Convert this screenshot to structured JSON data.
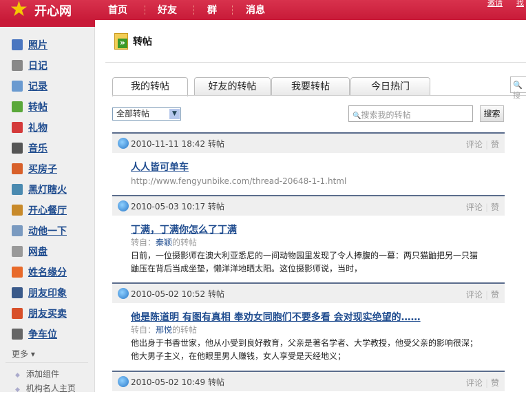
{
  "header": {
    "logo": "开心网",
    "nav": [
      "首页",
      "好友",
      "群",
      "消息"
    ],
    "top_links": [
      "邀请",
      "找"
    ]
  },
  "sidebar": {
    "items": [
      {
        "label": "照片",
        "icon": "photo-icon",
        "color": "#4a76c0"
      },
      {
        "label": "日记",
        "icon": "diary-icon",
        "color": "#888888"
      },
      {
        "label": "记录",
        "icon": "record-icon",
        "color": "#6a9ad0"
      },
      {
        "label": "转帖",
        "icon": "repost-icon",
        "color": "#5aa83a"
      },
      {
        "label": "礼物",
        "icon": "gift-icon",
        "color": "#d43a3a"
      },
      {
        "label": "音乐",
        "icon": "headphones-icon",
        "color": "#555555"
      },
      {
        "label": "买房子",
        "icon": "house-icon",
        "color": "#d8602a"
      },
      {
        "label": "黑灯瞎火",
        "icon": "people-icon",
        "color": "#4a8ab0"
      },
      {
        "label": "开心餐厅",
        "icon": "burger-icon",
        "color": "#c88a2a"
      },
      {
        "label": "动他一下",
        "icon": "poke-icon",
        "color": "#7a9ac0"
      },
      {
        "label": "网盘",
        "icon": "disk-icon",
        "color": "#999999"
      },
      {
        "label": "姓名缘分",
        "icon": "name-fate-icon",
        "color": "#e86a2a"
      },
      {
        "label": "朋友印象",
        "icon": "friend-impression-icon",
        "color": "#3a5a8a"
      },
      {
        "label": "朋友买卖",
        "icon": "friend-trade-icon",
        "color": "#d8502a"
      },
      {
        "label": "争车位",
        "icon": "parking-icon",
        "color": "#666666"
      }
    ],
    "more": "更多",
    "sub": [
      "添加组件",
      "机构名人主页"
    ]
  },
  "page": {
    "title": "转帖",
    "tabs": [
      "我的转帖",
      "好友的转帖",
      "我要转帖",
      "今日热门"
    ],
    "active_tab": 0,
    "filter": "全部转帖",
    "search_placeholder": "搜索我的转帖",
    "search_button": "搜索",
    "right_search": "搜"
  },
  "posts": [
    {
      "time": "2010-11-11 18:42 转帖",
      "comment": "评论",
      "like": "赞",
      "title": "人人皆可单车",
      "url": "http://www.fengyunbike.com/thread-20648-1-1.html"
    },
    {
      "time": "2010-05-03 10:17 转帖",
      "comment": "评论",
      "like": "赞",
      "title": "丁满，丁满你怎么了丁满",
      "from_prefix": "转自：",
      "from_user": "秦颖",
      "from_suffix": "的转帖",
      "text": [
        "日前，一位摄影师在澳大利亚悉尼的一间动物园里发现了令人捧腹的一幕：两只猫鼬把另一只猫",
        "鼬压在背后当成坐垫，懒洋洋地晒太阳。这位摄影师说，当时，"
      ]
    },
    {
      "time": "2010-05-02 10:52 转帖",
      "comment": "评论",
      "like": "赞",
      "title": "他是陈道明 有图有真相 奉劝女同胞们不要多看 会对现实绝望的……",
      "from_prefix": "转自：",
      "from_user": "邢悦",
      "from_suffix": "的转帖",
      "text": [
        "他出身于书香世家，他从小受到良好教育，父亲是著名学者、大学教授，他受父亲的影响很深；",
        "他大男子主义，在他眼里男人赚钱，女人享受是天经地义；"
      ]
    },
    {
      "time": "2010-05-02 10:49 转帖",
      "comment": "评论",
      "like": "赞"
    }
  ]
}
